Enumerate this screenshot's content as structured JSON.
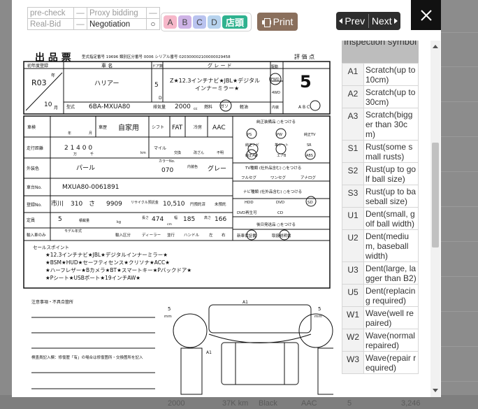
{
  "status": {
    "pre_check": "pre-check",
    "pre_check_mark": "—",
    "proxy_bidding": "Proxy bidding",
    "proxy_bidding_mark": "—",
    "real_bid": "Real-Bid",
    "real_bid_mark": "—",
    "negotiation": "Negotiation",
    "negotiation_mark": "○"
  },
  "badges": [
    "A",
    "B",
    "C",
    "D"
  ],
  "shop_badge": "店頭",
  "print_label": "Print",
  "nav": {
    "prev": "Prev",
    "next": "Next"
  },
  "close_label": "✕",
  "colors": {
    "print": "#8a6f5c",
    "nav": "#2d2d2d",
    "shop": "#2fb28f",
    "badge_a": "#f6b7c9",
    "badge_b": "#ceb3e6",
    "badge_c": "#b9c3ef",
    "badge_d": "#b7d3ee"
  },
  "sheet": {
    "title": "出 品 票",
    "header_small": "型式指定番号  19696   類別区分番号  0006   シリアル番号  020300002100000029458",
    "score_label": "評 価 点",
    "score": "5",
    "first_reg_label": "初年度登録",
    "first_reg": "R03",
    "year_unit": "年",
    "month": "10",
    "month_unit": "月",
    "name_label": "車 名",
    "name": "ハリアー",
    "doors_label": "ドア数",
    "doors": "5",
    "doors_d": "D",
    "grade_label": "グ レ ー ド",
    "grade_line1": "Z★12.3インチナビ★JBL★デジタル",
    "grade_line2": "インナーミラー★",
    "drive_label": "駆動",
    "drive_fwd": "FWD",
    "drive_4wd": "4WD",
    "model_label": "型式",
    "model": "6BA-MXUA80",
    "displacement_label": "排気量",
    "displacement": "2000",
    "cc": "cc",
    "fuel_label": "燃料",
    "fuel": "ガソ",
    "light_label": "軽油",
    "interior_label": "内装",
    "interior_grades": "A  B  C",
    "inspection_label": "車検",
    "inspection_year": "年",
    "inspection_month": "月",
    "car_class_label": "車歴",
    "car_class": "自家用",
    "shift_label": "シフト",
    "shift": "FAT",
    "ac_label": "冷房",
    "ac": "AAC",
    "mileage_label": "走行距離",
    "mileage_digits": "2  1  4  0  0",
    "mileage_unit": "km",
    "mileage_man": "万",
    "mileage_sen": "千",
    "meter_label": "マイル",
    "meter_change": "交換",
    "meter_tamper": "改ざん",
    "meter_unknown": "不明",
    "color_label": "外装色",
    "color": "パール",
    "color_no_label": "カラーNo.",
    "color_no": "070",
    "interior_color_label": "内装色",
    "interior_color": "グレー",
    "vin_label": "車台No.",
    "vin": "MXUA80-0061891",
    "plate_label": "登録No.",
    "plate_region": "市川",
    "plate_class": "310",
    "plate_kana": "さ",
    "plate_number": "9909",
    "recycle_label": "リサイクル預託金",
    "recycle": "10,510",
    "recycle_unit": "円預託済",
    "recycle_unpaid": "未預託",
    "capacity_label": "定員",
    "capacity": "5",
    "load_label": "積載量",
    "load_unit": "kg",
    "length_label": "長さ",
    "length": "474",
    "width_label": "幅",
    "width": "185",
    "height_label": "高さ",
    "height": "166",
    "dims_unit": "cm",
    "import_label": "輸入車のみ",
    "model_year_label": "モデル年式",
    "import_type_label": "輸入区分",
    "dealer": "ディーラー",
    "parallel": "並行",
    "handle_label": "ハンドル",
    "handle_left": "左",
    "handle_right": "右",
    "equip_label": "純正装備品  ○をつける",
    "equip": [
      "PS",
      "PW",
      "純正TV",
      "純正ナビ",
      "革シート",
      "SR",
      "純正AW",
      "エアB",
      "ABS"
    ],
    "tv_label": "TV種類 (社外品含む)  ○をつける",
    "tv": [
      "フルセグ",
      "ワンセグ",
      "アナログ"
    ],
    "navi_label": "ナビ種類 (社外品含む)  ○をつける",
    "navi": [
      "HDD",
      "DVD",
      "SD",
      "DVD再生可",
      "CD"
    ],
    "extra_label": "後日発送品  ○をつける",
    "extra": [
      "新車保証書",
      "取扱説明書"
    ],
    "sales_label": "セールスポイント",
    "sales": [
      "★12.3インチナビ★JBL★デジタルインナーミラー★",
      "★BSM★HUD★セーフティセンス★クリソナ★ACC★",
      "★ハーフレザー★Bカメラ★BT★スマートキー★Pバックドア★",
      "★Pシート★USBポート★19インチAW★"
    ],
    "notes_label": "注意事項・不具合箇所",
    "mm": "mm",
    "five": "5",
    "a1": "A1",
    "inspector_label": "検査員記入欄：修復歴「有」の場合は修復箇所・交換箇所を記入"
  },
  "symbols": {
    "header": "Inspection symbol",
    "items": [
      {
        "code": "A1",
        "desc": "Scratch(up to 10cm)"
      },
      {
        "code": "A2",
        "desc": "Scratch(up to 30cm)"
      },
      {
        "code": "A3",
        "desc": "Scratch(bigger than 30cm)"
      },
      {
        "code": "S1",
        "desc": "Rust(some small rusts)"
      },
      {
        "code": "S2",
        "desc": "Rust(up to golf ball size)"
      },
      {
        "code": "S3",
        "desc": "Rust(up to baseball size)"
      },
      {
        "code": "U1",
        "desc": "Dent(small, golf ball width)"
      },
      {
        "code": "U2",
        "desc": "Dent(medium, baseball width)"
      },
      {
        "code": "U3",
        "desc": "Dent(large, lagger than B2)"
      },
      {
        "code": "U5",
        "desc": "Dent(replacing required)"
      },
      {
        "code": "W1",
        "desc": "Wave(well repaired)"
      },
      {
        "code": "W2",
        "desc": "Wave(normal repaired)"
      },
      {
        "code": "W3",
        "desc": "Wave(repair required)"
      }
    ]
  },
  "background": {
    "cc": "2000",
    "km": "37K km",
    "color": "Black",
    "ac": "AAC",
    "grade": "5",
    "price": "3,246"
  }
}
